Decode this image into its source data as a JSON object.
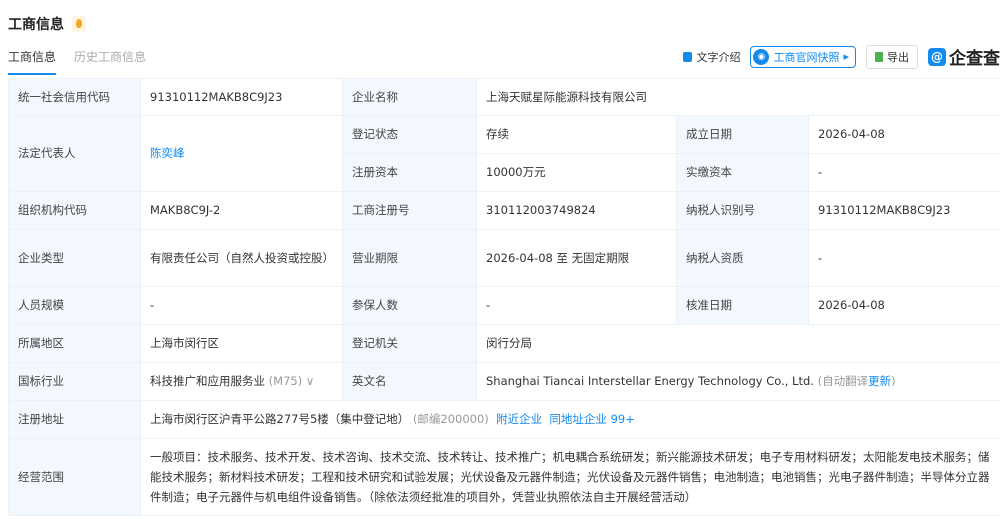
{
  "header": {
    "title": "工商信息",
    "tabs": [
      "工商信息",
      "历史工商信息"
    ],
    "tools": {
      "text_intro": "文字介绍",
      "snapshot": "工商官网快照",
      "export": "导出",
      "logo": "企查查"
    }
  },
  "rows": {
    "credit_code": {
      "label": "统一社会信用代码",
      "value": "91310112MAKB8C9J23"
    },
    "name": {
      "label": "企业名称",
      "value": "上海天赋星际能源科技有限公司"
    },
    "legal_rep": {
      "label": "法定代表人",
      "value": "陈奕峰"
    },
    "status": {
      "label": "登记状态",
      "value": "存续"
    },
    "founded": {
      "label": "成立日期",
      "value": "2026-04-08"
    },
    "capital": {
      "label": "注册资本",
      "value": "10000万元"
    },
    "paid": {
      "label": "实缴资本",
      "value": "-"
    },
    "org_code": {
      "label": "组织机构代码",
      "value": "MAKB8C9J-2"
    },
    "reg_no": {
      "label": "工商注册号",
      "value": "310112003749824"
    },
    "tax_id": {
      "label": "纳税人识别号",
      "value": "91310112MAKB8C9J23"
    },
    "type": {
      "label": "企业类型",
      "value": "有限责任公司（自然人投资或控股）"
    },
    "term": {
      "label": "营业期限",
      "value": "2026-04-08 至 无固定期限"
    },
    "tax_qual": {
      "label": "纳税人资质",
      "value": "-"
    },
    "staff": {
      "label": "人员规模",
      "value": "-"
    },
    "insured": {
      "label": "参保人数",
      "value": "-"
    },
    "approved": {
      "label": "核准日期",
      "value": "2026-04-08"
    },
    "region": {
      "label": "所属地区",
      "value": "上海市闵行区"
    },
    "authority": {
      "label": "登记机关",
      "value": "闵行分局"
    },
    "industry": {
      "label": "国标行业",
      "value": "科技推广和应用服务业",
      "code": "(M75)"
    },
    "english": {
      "label": "英文名",
      "value": "Shanghai Tiancai Interstellar Energy Technology Co., Ltd.",
      "note": "(自动翻译",
      "update": "更新",
      "close": ")"
    },
    "address": {
      "label": "注册地址",
      "value": "上海市闵行区沪青平公路277号5楼（集中登记地）",
      "zip": "(邮编200000)",
      "nearby": "附近企业",
      "same": "同地址企业 99+"
    },
    "scope": {
      "label": "经营范围",
      "value": "一般项目：技术服务、技术开发、技术咨询、技术交流、技术转让、技术推广；机电耦合系统研发；新兴能源技术研发；电子专用材料研发；太阳能发电技术服务；储能技术服务；新材料技术研发；工程和技术研究和试验发展；光伏设备及元器件制造；光伏设备及元器件销售；电池制造；电池销售；光电子器件制造；半导体分立器件制造；电子元器件与机电组件设备销售。（除依法须经批准的项目外，凭营业执照依法自主开展经营活动）"
    }
  }
}
